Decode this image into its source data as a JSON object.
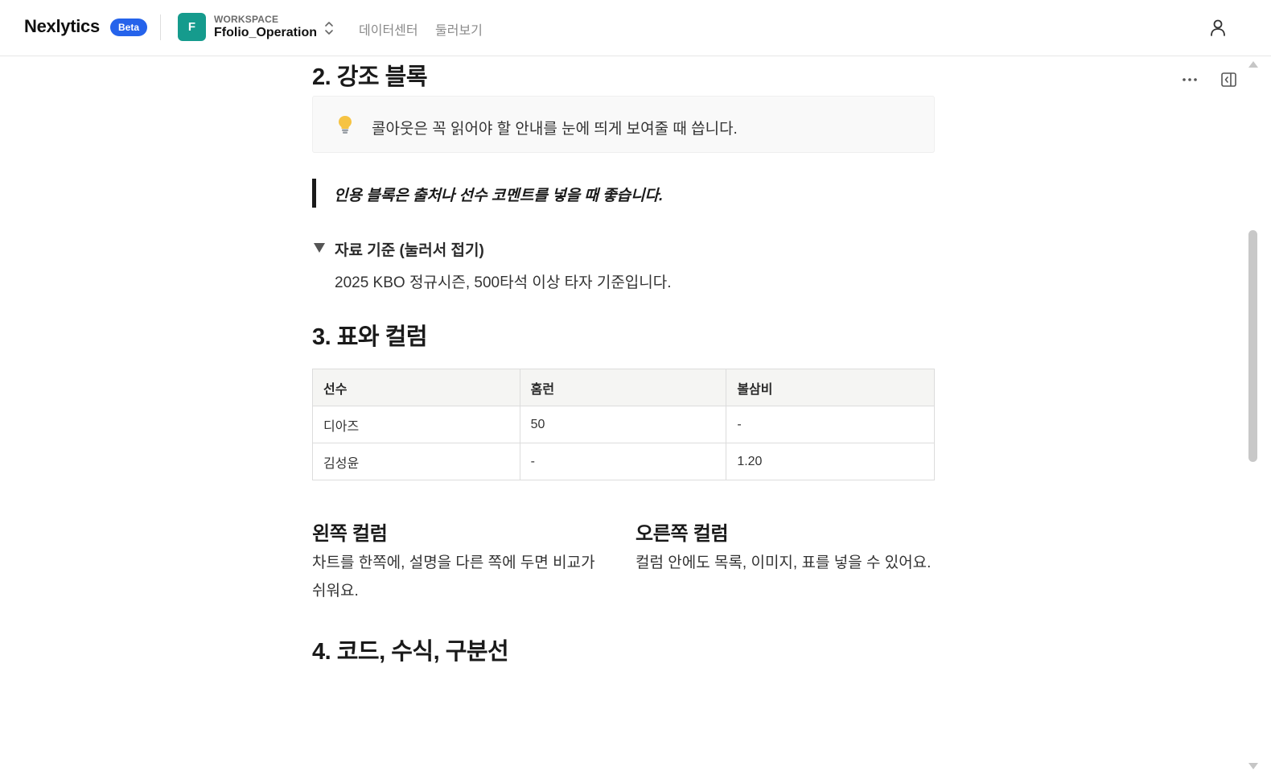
{
  "header": {
    "logo": "Nexlytics",
    "badge": "Beta",
    "workspace": {
      "avatar_letter": "F",
      "caption": "WORKSPACE",
      "name": "Ffolio_Operation",
      "avatar_color": "#159b8d"
    },
    "nav": [
      "데이터센터",
      "둘러보기"
    ],
    "user_icon": "user-icon",
    "accent_color": "#2563eb"
  },
  "toolbar": {
    "more_icon": "more-horizontal-icon",
    "panel_icon": "collapse-panel-icon"
  },
  "document": {
    "section2": {
      "heading": "2. 강조 블록",
      "callout": {
        "icon": "lightbulb-icon",
        "text": "콜아웃은 꼭 읽어야 할 안내를 눈에 띄게 보여줄 때 씁니다."
      },
      "quote": "인용 블록은 출처나 선수 코멘트를 넣을 때 좋습니다.",
      "toggle": {
        "title": "자료 기준 (눌러서 접기)",
        "body": "2025 KBO 정규시즌, 500타석 이상 타자 기준입니다."
      }
    },
    "section3": {
      "heading": "3. 표와 컬럼",
      "table": {
        "columns": [
          "선수",
          "홈런",
          "볼삼비"
        ],
        "rows": [
          [
            "디아즈",
            "50",
            "-"
          ],
          [
            "김성윤",
            "-",
            "1.20"
          ]
        ]
      },
      "columns": {
        "left": {
          "title": "왼쪽 컬럼",
          "text": "차트를 한쪽에, 설명을 다른 쪽에 두면 비교가 쉬워요."
        },
        "right": {
          "title": "오른쪽 컬럼",
          "text": "컬럼 안에도 목록, 이미지, 표를 넣을 수 있어요."
        }
      }
    },
    "section4": {
      "heading": "4. 코드, 수식, 구분선"
    }
  }
}
